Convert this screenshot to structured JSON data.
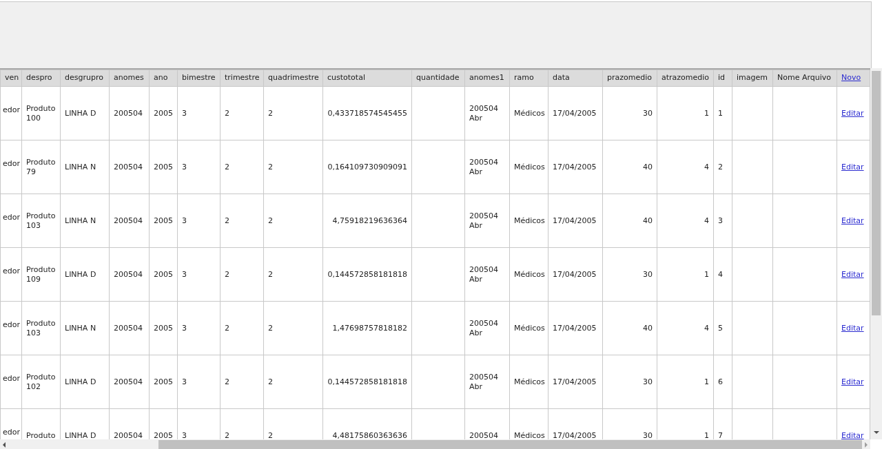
{
  "table": {
    "columns": [
      {
        "label": "ven",
        "kind": "text"
      },
      {
        "label": "despro",
        "kind": "text"
      },
      {
        "label": "desgrupro",
        "kind": "text"
      },
      {
        "label": "anomes",
        "kind": "text"
      },
      {
        "label": "ano",
        "kind": "text"
      },
      {
        "label": "bimestre",
        "kind": "text"
      },
      {
        "label": "trimestre",
        "kind": "text"
      },
      {
        "label": "quadrimestre",
        "kind": "text"
      },
      {
        "label": "custototal",
        "kind": "text"
      },
      {
        "label": "quantidade",
        "kind": "text"
      },
      {
        "label": "anomes1",
        "kind": "text"
      },
      {
        "label": "ramo",
        "kind": "text"
      },
      {
        "label": "data",
        "kind": "text"
      },
      {
        "label": "prazomedio",
        "kind": "text"
      },
      {
        "label": "atrazomedio",
        "kind": "text"
      },
      {
        "label": "id",
        "kind": "text"
      },
      {
        "label": "imagem",
        "kind": "text"
      },
      {
        "label": "Nome Arquivo",
        "kind": "text"
      },
      {
        "label": "Novo",
        "kind": "link"
      }
    ],
    "rows": [
      [
        "edor",
        "Produto 100",
        "LINHA D",
        "200504",
        "2005",
        "3",
        "2",
        "2",
        "0,433718574545455",
        null,
        "200504 Abr",
        "Médicos",
        "17/04/2005",
        "30",
        "1",
        "1",
        null,
        null,
        "Editar"
      ],
      [
        "edor",
        "Produto 79",
        "LINHA N",
        "200504",
        "2005",
        "3",
        "2",
        "2",
        "0,164109730909091",
        null,
        "200504 Abr",
        "Médicos",
        "17/04/2005",
        "40",
        "4",
        "2",
        null,
        null,
        "Editar"
      ],
      [
        "edor",
        "Produto 103",
        "LINHA N",
        "200504",
        "2005",
        "3",
        "2",
        "2",
        "4,75918219636364",
        null,
        "200504 Abr",
        "Médicos",
        "17/04/2005",
        "40",
        "4",
        "3",
        null,
        null,
        "Editar"
      ],
      [
        "edor",
        "Produto 109",
        "LINHA D",
        "200504",
        "2005",
        "3",
        "2",
        "2",
        "0,144572858181818",
        null,
        "200504 Abr",
        "Médicos",
        "17/04/2005",
        "30",
        "1",
        "4",
        null,
        null,
        "Editar"
      ],
      [
        "edor",
        "Produto 103",
        "LINHA N",
        "200504",
        "2005",
        "3",
        "2",
        "2",
        "1,47698757818182",
        null,
        "200504 Abr",
        "Médicos",
        "17/04/2005",
        "40",
        "4",
        "5",
        null,
        null,
        "Editar"
      ],
      [
        "edor",
        "Produto 102",
        "LINHA D",
        "200504",
        "2005",
        "3",
        "2",
        "2",
        "0,144572858181818",
        null,
        "200504 Abr",
        "Médicos",
        "17/04/2005",
        "30",
        "1",
        "6",
        null,
        null,
        "Editar"
      ],
      [
        "edor",
        "Produto",
        "LINHA D",
        "200504",
        "2005",
        "3",
        "2",
        "2",
        "4,48175860363636",
        null,
        "200504",
        "Médicos",
        "17/04/2005",
        "30",
        "1",
        "7",
        null,
        null,
        "Editar"
      ]
    ]
  }
}
